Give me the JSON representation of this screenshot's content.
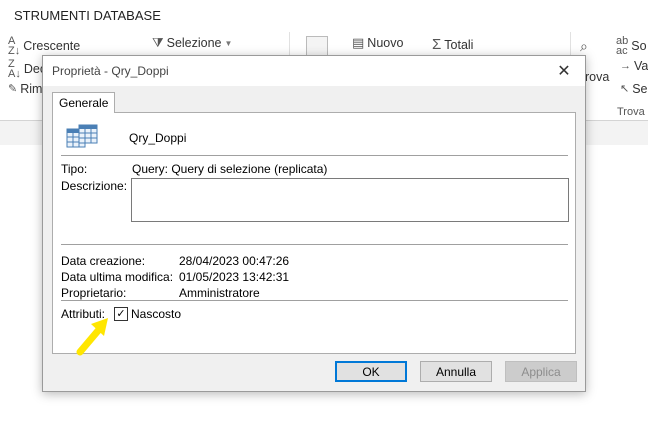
{
  "ribbon": {
    "tab_title": "STRUMENTI DATABASE",
    "sort_asc": "Crescente",
    "sort_desc": "Dec",
    "sort_remove": "Rim",
    "selection": "Selezione",
    "new": "Nuovo",
    "totals": "Totali",
    "find": "rova",
    "find_group": "Trova",
    "right_1": "So",
    "right_2": "Va",
    "right_3": "Se"
  },
  "dialog": {
    "title": "Proprietà - Qry_Doppi",
    "tab_general": "Generale",
    "object_name": "Qry_Doppi",
    "type_label": "Tipo:",
    "type_value": "Query: Query di selezione (replicata)",
    "description_label": "Descrizione:",
    "description_value": "",
    "created_label": "Data creazione:",
    "created_value": "28/04/2023 00:47:26",
    "modified_label": "Data ultima modifica:",
    "modified_value": "01/05/2023 13:42:31",
    "owner_label": "Proprietario:",
    "owner_value": "Amministratore",
    "attributes_label": "Attributi:",
    "hidden_label": "Nascosto",
    "hidden_checked": true,
    "ok_label": "OK",
    "cancel_label": "Annulla",
    "apply_label": "Applica"
  },
  "colors": {
    "highlight_arrow": "#ffe600",
    "ok_focus": "#0078d7",
    "dialog_bg": "#f0f0f0"
  }
}
